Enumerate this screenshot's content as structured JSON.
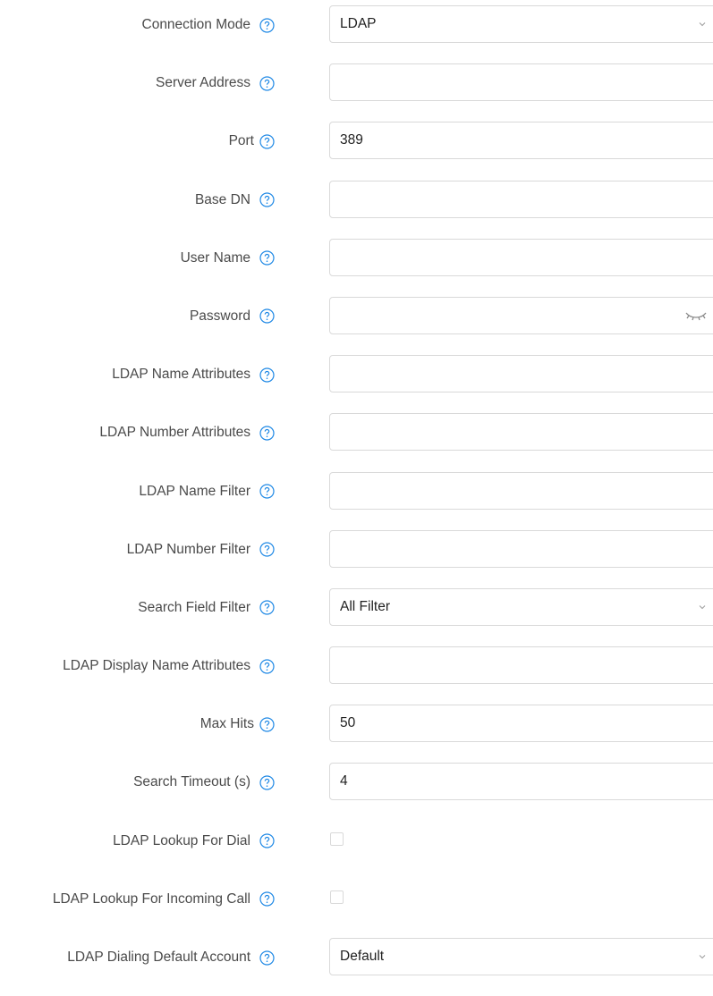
{
  "form": {
    "fields": [
      {
        "label": "Connection Mode",
        "type": "select",
        "value": "LDAP"
      },
      {
        "label": "Server Address",
        "type": "text",
        "value": ""
      },
      {
        "label": "Port",
        "type": "text",
        "value": "389"
      },
      {
        "label": "Base DN",
        "type": "text",
        "value": ""
      },
      {
        "label": "User Name",
        "type": "text",
        "value": ""
      },
      {
        "label": "Password",
        "type": "password",
        "value": ""
      },
      {
        "label": "LDAP Name Attributes",
        "type": "text",
        "value": ""
      },
      {
        "label": "LDAP Number Attributes",
        "type": "text",
        "value": ""
      },
      {
        "label": "LDAP Name Filter",
        "type": "text",
        "value": ""
      },
      {
        "label": "LDAP Number Filter",
        "type": "text",
        "value": ""
      },
      {
        "label": "Search Field Filter",
        "type": "select",
        "value": "All Filter"
      },
      {
        "label": "LDAP Display Name Attributes",
        "type": "text",
        "value": ""
      },
      {
        "label": "Max Hits",
        "type": "text",
        "value": "50"
      },
      {
        "label": "Search Timeout (s)",
        "type": "text",
        "value": "4"
      },
      {
        "label": "LDAP Lookup For Dial",
        "type": "checkbox",
        "checked": false
      },
      {
        "label": "LDAP Lookup For Incoming Call",
        "type": "checkbox",
        "checked": false
      },
      {
        "label": "LDAP Dialing Default Account",
        "type": "select",
        "value": "Default"
      }
    ]
  },
  "icons": {
    "help": "question-circle-icon",
    "dropdown": "chevron-down-icon",
    "password_toggle": "eye-closed-icon"
  },
  "colors": {
    "help_icon": "#1e88e5",
    "border": "#d9d9d9",
    "label": "#4a4a4a",
    "value": "#222222"
  }
}
